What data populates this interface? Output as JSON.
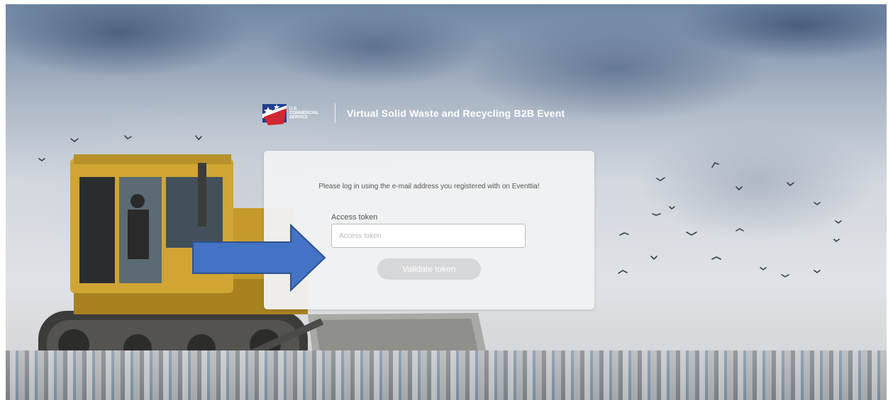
{
  "brand": {
    "logo_text": "U.S. COMMERCIAL SERVICE",
    "event_title": "Virtual Solid Waste and Recycling B2B Event"
  },
  "login": {
    "message": "Please log in using the e-mail address you registered with on Eventtia!",
    "field_label": "Access token",
    "field_placeholder": "Access token",
    "field_value": "",
    "button_label": "Validate token"
  },
  "colors": {
    "arrow": "#4472c4",
    "arrow_border": "#2f528f",
    "button": "#d6d7d9",
    "card": "#f0f1f3"
  },
  "icons": {
    "logo": "us-flag-logo",
    "arrow": "right-arrow-annotation"
  }
}
